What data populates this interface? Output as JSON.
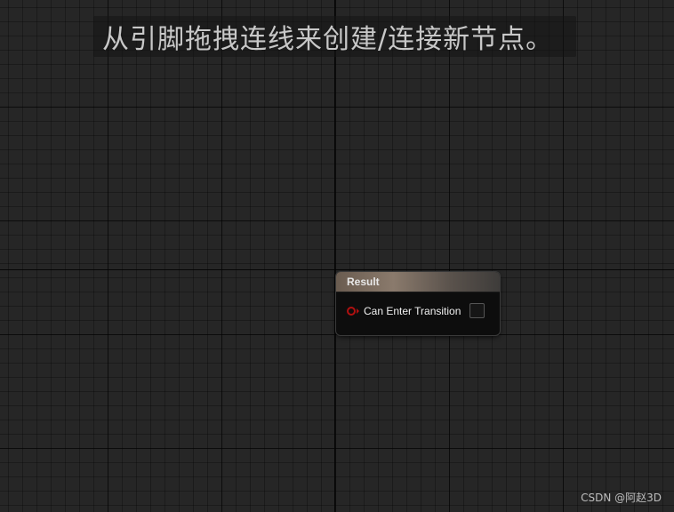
{
  "hint": {
    "text": "从引脚拖拽连线来创建/连接新节点。"
  },
  "node": {
    "title": "Result",
    "pin": {
      "label": "Can Enter Transition",
      "checked": false,
      "color": "#b01010"
    },
    "header_color": "#8a7a6c"
  },
  "watermark": {
    "text": "CSDN @阿赵3D"
  },
  "colors": {
    "background": "#262626",
    "grid_major": "#0a0a0a"
  }
}
